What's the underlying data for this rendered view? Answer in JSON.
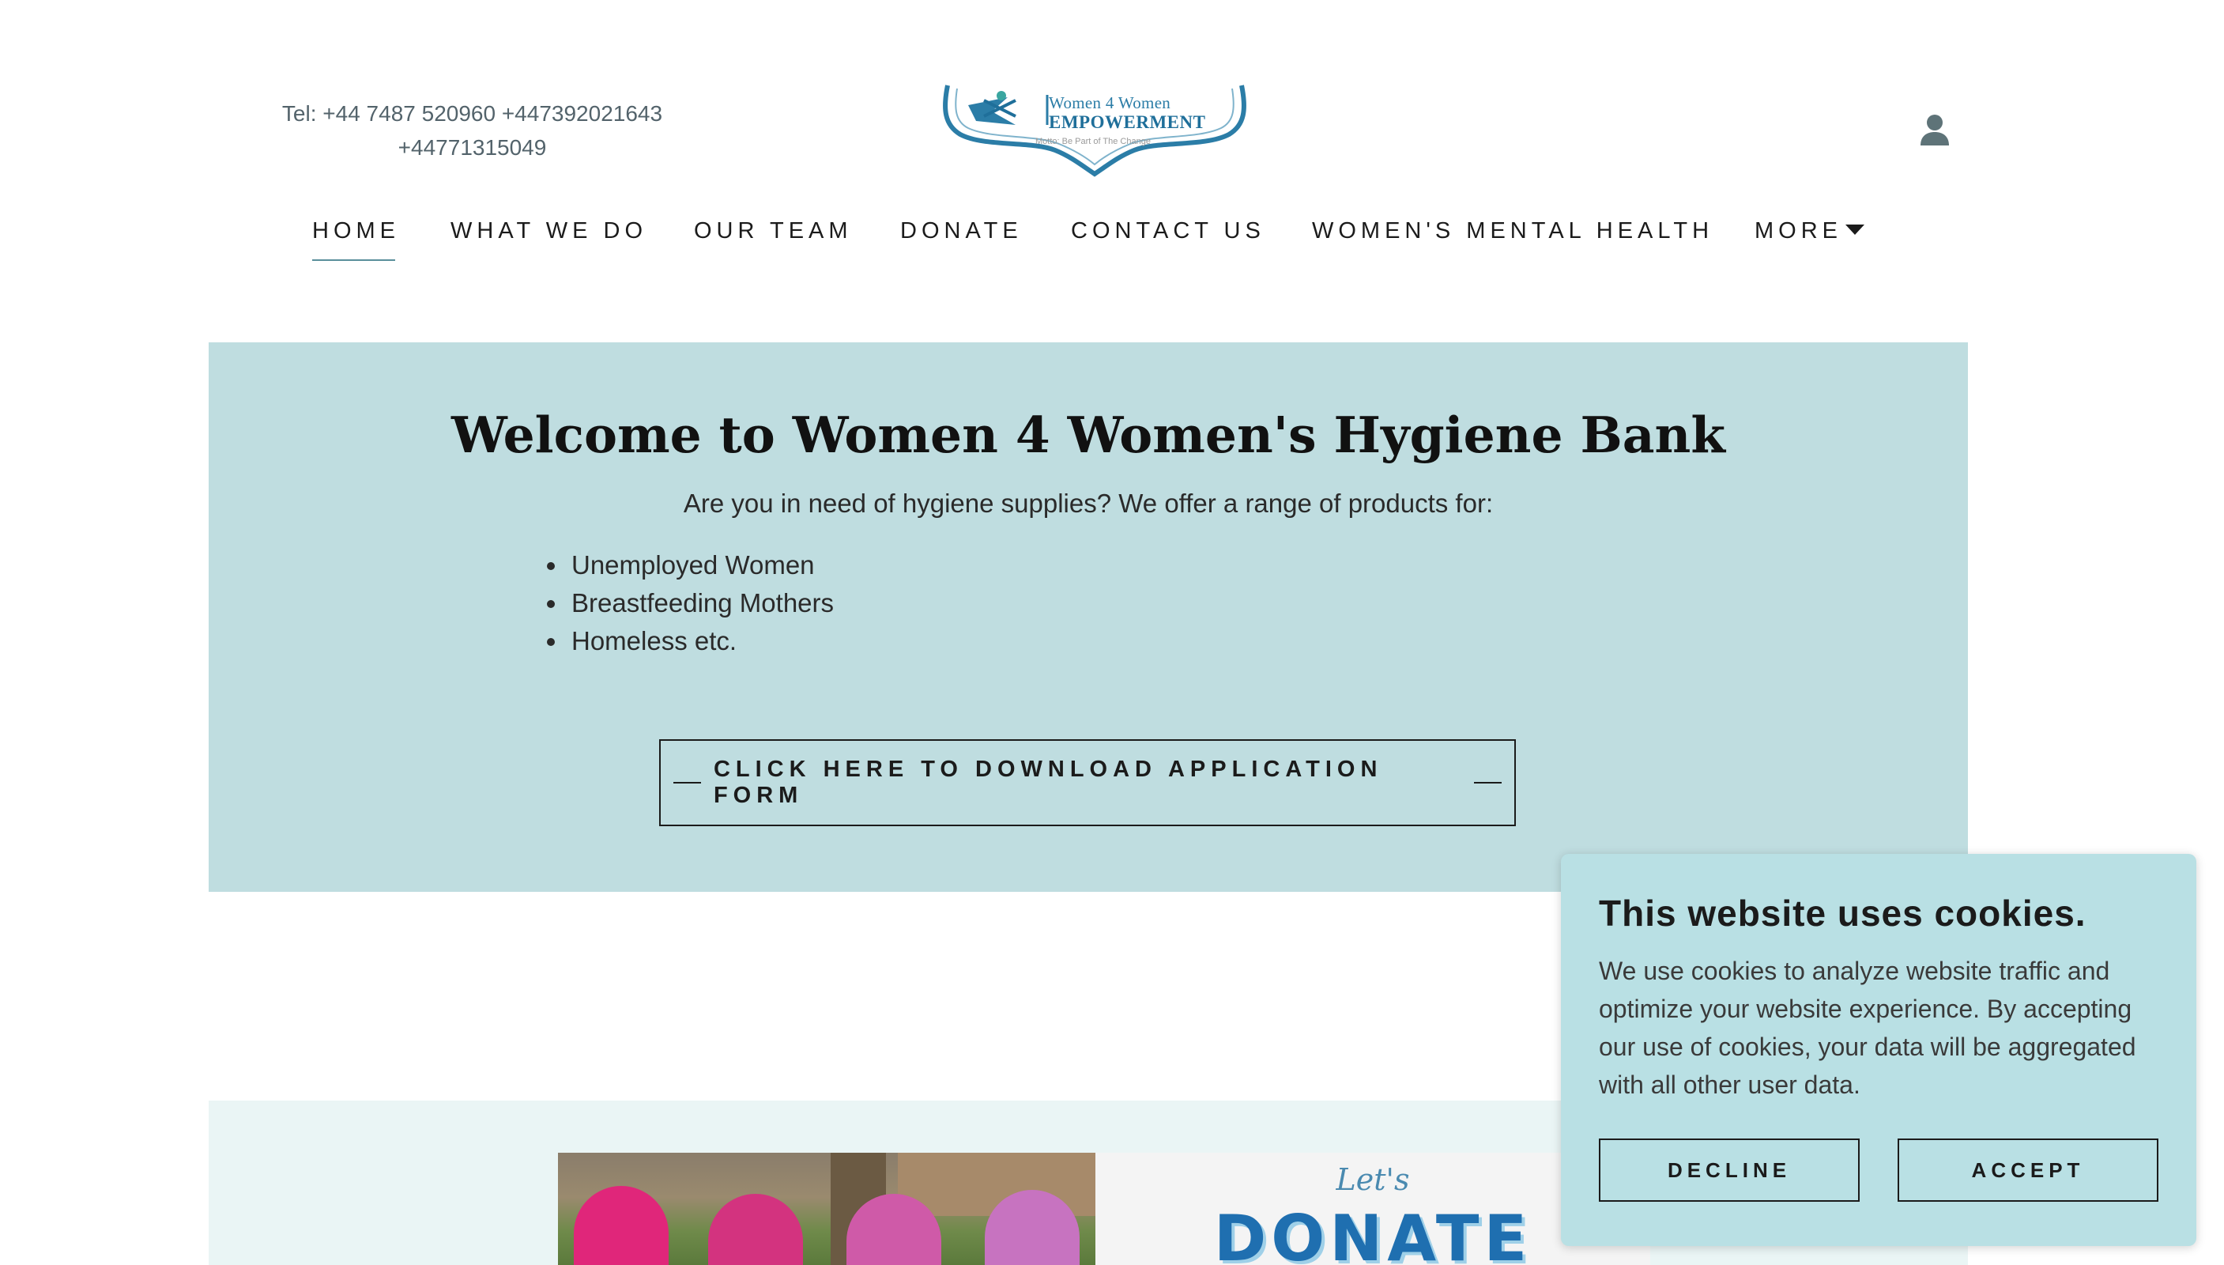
{
  "header": {
    "tel": "Tel: +44 7487 520960 +447392021643 +44771315049",
    "logo": {
      "line1": "Women 4 Women",
      "line2": "EMPOWERMENT",
      "motto": "Motto: Be Part of The Change"
    }
  },
  "nav": {
    "items": [
      {
        "label": "HOME",
        "active": true
      },
      {
        "label": "WHAT WE DO"
      },
      {
        "label": "OUR TEAM"
      },
      {
        "label": "DONATE"
      },
      {
        "label": "CONTACT US"
      },
      {
        "label": "WOMEN'S MENTAL HEALTH"
      },
      {
        "label": "MORE"
      }
    ]
  },
  "hero": {
    "title": "Welcome to Women 4 Women's Hygiene Bank",
    "subtitle": "Are you in need of hygiene supplies? We offer a range of products for:",
    "list": [
      "Unemployed Women",
      "Breastfeeding Mothers",
      "Homeless etc."
    ],
    "cta_label": "CLICK HERE TO DOWNLOAD APPLICATION FORM",
    "background": "#bfdde0"
  },
  "donate_graphic": {
    "lets": "Let's",
    "word": "DONATE"
  },
  "cookie": {
    "title": "This website uses cookies.",
    "body": "We use cookies to analyze website traffic and optimize your website experience. By accepting our use of cookies, your data will be aggregated with all other user data.",
    "decline": "DECLINE",
    "accept": "ACCEPT",
    "background": "#b9e0e4"
  },
  "colors": {
    "accent": "#5a8f9b",
    "logo_blue": "#1f6f9a"
  }
}
